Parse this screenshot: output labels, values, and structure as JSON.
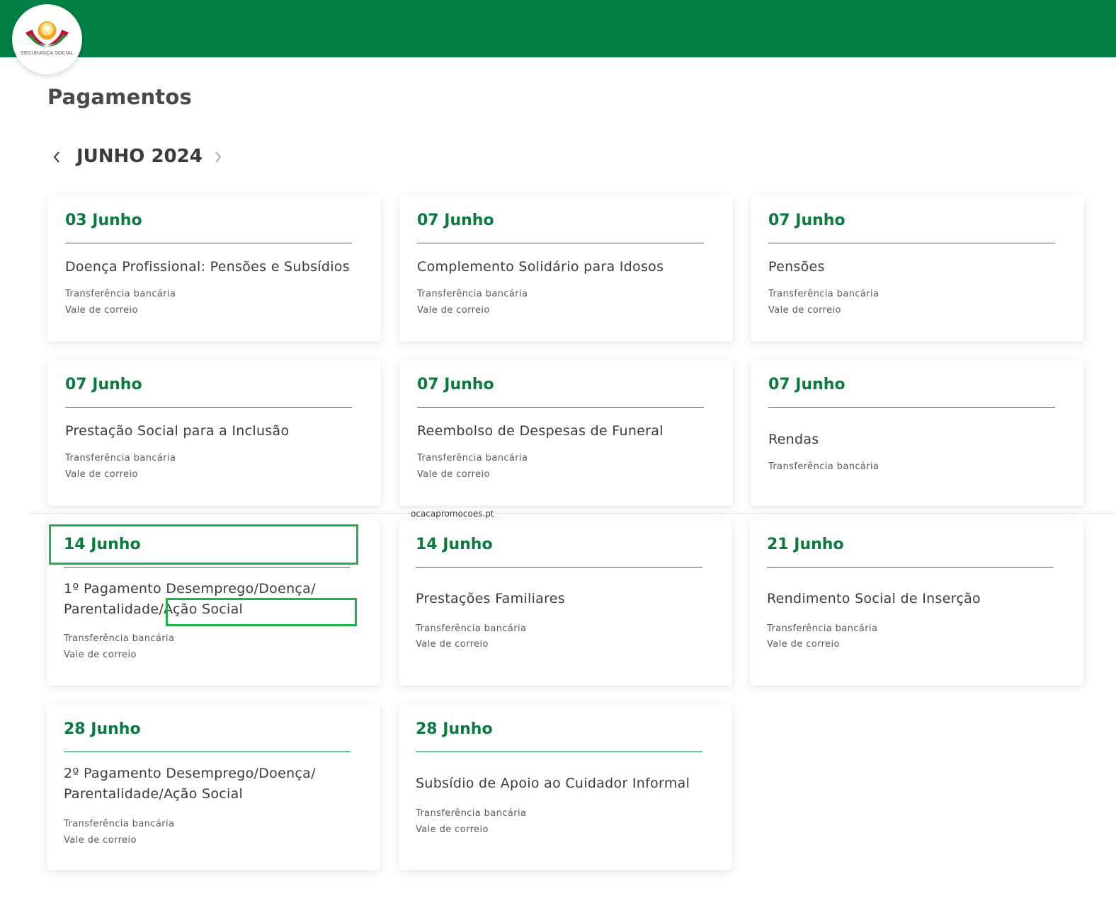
{
  "header": {
    "logo_text": "SEGURANÇA SOCIAL",
    "brand_color": "#008045"
  },
  "page": {
    "title": "Pagamentos",
    "month": "JUNHO 2024"
  },
  "cards": [
    {
      "date": "03 Junho",
      "title": "Doença Profissional: Pensões e Subsídios",
      "methods": [
        "Transferência bancária",
        "Vale de correio"
      ]
    },
    {
      "date": "07 Junho",
      "title": "Complemento Solidário para Idosos",
      "methods": [
        "Transferência bancária",
        "Vale de correio"
      ]
    },
    {
      "date": "07 Junho",
      "title": "Pensões",
      "methods": [
        "Transferência bancária",
        "Vale de correio"
      ]
    },
    {
      "date": "07 Junho",
      "title": "Prestação Social para a Inclusão",
      "methods": [
        "Transferência bancária",
        "Vale de correio"
      ]
    },
    {
      "date": "07 Junho",
      "title": "Reembolso de Despesas de Funeral",
      "methods": [
        "Transferência bancária",
        "Vale de correio"
      ]
    },
    {
      "date": "07 Junho",
      "title": "Rendas",
      "methods": [
        "Transferência bancária"
      ]
    },
    {
      "date": "14 Junho",
      "title": "1º Pagamento Desemprego/Doença/ Parentalidade/Ação Social",
      "methods": [
        "Transferência bancária",
        "Vale de correio"
      ]
    },
    {
      "date": "14 Junho",
      "title": "Prestações Familiares",
      "methods": [
        "Transferência bancária",
        "Vale de correio"
      ]
    },
    {
      "date": "21 Junho",
      "title": "Rendimento Social de Inserção",
      "methods": [
        "Transferência bancária",
        "Vale de correio"
      ]
    },
    {
      "date": "28 Junho",
      "title": "2º Pagamento Desemprego/Doença/ Parentalidade/Ação Social",
      "methods": [
        "Transferência bancária",
        "Vale de correio"
      ]
    },
    {
      "date": "28 Junho",
      "title": "Subsídio de Apoio ao Cuidador Informal",
      "methods": [
        "Transferência bancária",
        "Vale de correio"
      ]
    }
  ],
  "watermark": "ocacapromocoes.pt",
  "icons": {
    "prev": "chevron-left-icon",
    "next": "chevron-right-icon",
    "logo": "seguranca-social-logo-icon"
  }
}
